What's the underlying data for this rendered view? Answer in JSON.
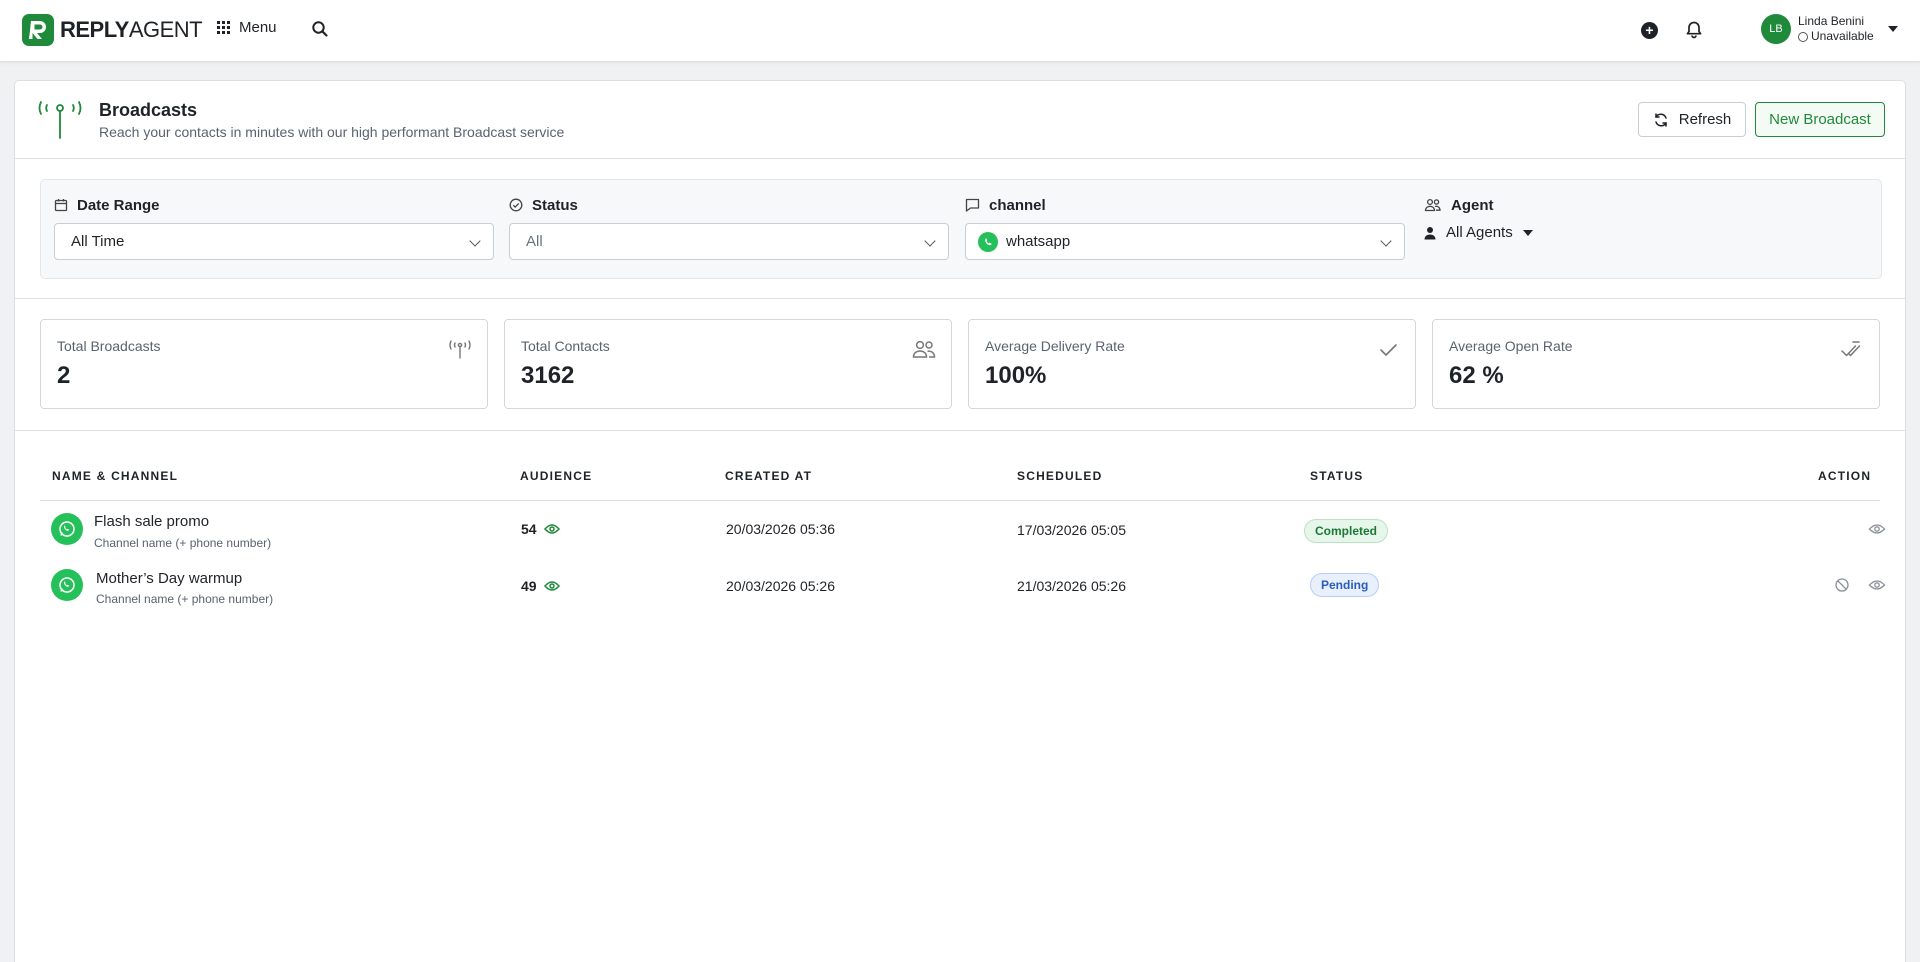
{
  "brand": {
    "logo_bold": "REPLY",
    "logo_light": "AGENT"
  },
  "nav": {
    "menu_label": "Menu"
  },
  "user": {
    "initials": "LB",
    "name": "Linda Benini",
    "status": "Unavailable"
  },
  "page": {
    "title": "Broadcasts",
    "subtitle": "Reach your contacts in minutes with our high performant Broadcast service",
    "refresh_label": "Refresh",
    "new_label": "New Broadcast"
  },
  "filters": {
    "date_range": {
      "label": "Date Range",
      "value": "All Time"
    },
    "status": {
      "label": "Status",
      "value": "All"
    },
    "channel": {
      "label": "channel",
      "value": "whatsapp"
    },
    "agent": {
      "label": "Agent",
      "value": "All Agents"
    }
  },
  "stats": [
    {
      "label": "Total Broadcasts",
      "value": "2",
      "icon": "broadcast-icon"
    },
    {
      "label": "Total Contacts",
      "value": "3162",
      "icon": "users-icon"
    },
    {
      "label": "Average Delivery Rate",
      "value": "100%",
      "icon": "check-icon"
    },
    {
      "label": "Average Open Rate",
      "value": "62 %",
      "icon": "double-check-icon"
    }
  ],
  "table": {
    "headers": [
      "NAME & CHANNEL",
      "AUDIENCE",
      "CREATED AT",
      "SCHEDULED",
      "STATUS",
      "ACTION"
    ],
    "rows": [
      {
        "name": "Flash sale promo",
        "channel": "Channel name (+ phone number)",
        "audience": "54",
        "created": "20/03/2026 05:36",
        "scheduled": "17/03/2026 05:05",
        "status": "Completed"
      },
      {
        "name": "Mother’s Day warmup",
        "channel": "Channel name (+ phone number)",
        "audience": "49",
        "created": "20/03/2026 05:26",
        "scheduled": "21/03/2026 05:26",
        "status": "Pending"
      }
    ]
  },
  "colors": {
    "brand_green": "#1e8a3a",
    "whatsapp_green": "#25c05a",
    "completed_text": "#1a7a34",
    "pending_text": "#2a5db8"
  }
}
